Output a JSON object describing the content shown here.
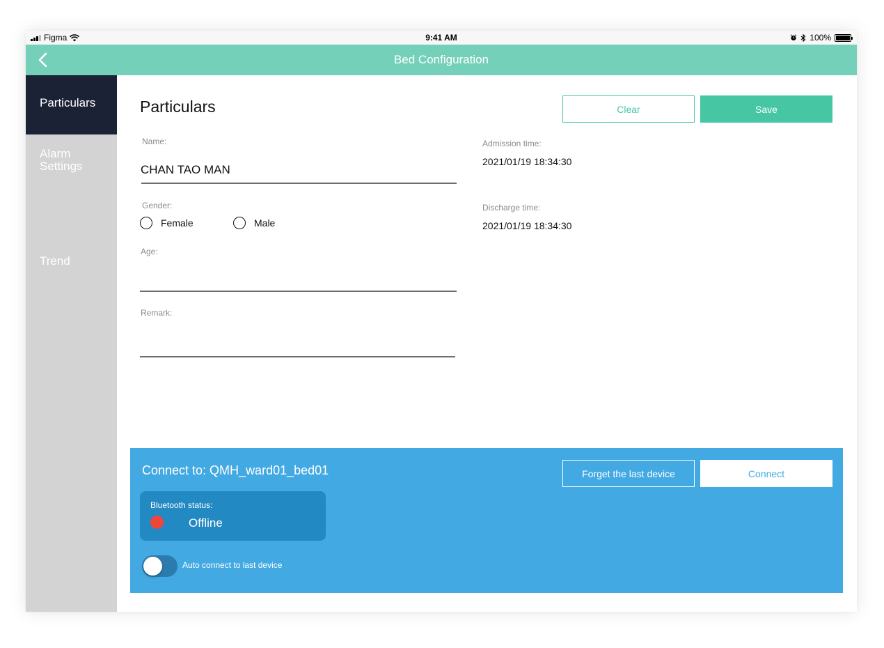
{
  "status_bar": {
    "carrier": "Figma",
    "time": "9:41 AM",
    "battery": "100%",
    "battery_level": 1.0,
    "icons": [
      "signal-icon",
      "wifi-icon",
      "alarm-icon",
      "bluetooth-icon",
      "battery-icon"
    ]
  },
  "nav": {
    "title": "Bed Configuration",
    "back_icon": "chevron-left-icon"
  },
  "sidebar": {
    "items": [
      {
        "label": "Particulars",
        "active": true
      },
      {
        "label": "Alarm Settings",
        "active": false
      },
      {
        "label": "Trend",
        "active": false
      }
    ]
  },
  "main": {
    "title": "Particulars",
    "clear_label": "Clear",
    "save_label": "Save",
    "name_label": "Name:",
    "name_value": "CHAN TAO MAN",
    "gender_label": "Gender:",
    "gender_options": [
      "Female",
      "Male"
    ],
    "age_label": "Age:",
    "age_value": "",
    "remark_label": "Remark:",
    "remark_value": "",
    "admission_label": "Admission time:",
    "admission_value": "2021/01/19 18:34:30",
    "discharge_label": "Discharge time:",
    "discharge_value": "2021/01/19 18:34:30"
  },
  "connect": {
    "title": "Connect to: QMH_ward01_bed01",
    "forget_label": "Forget the last device",
    "connect_label": "Connect",
    "bt_status_label": "Bluetooth status:",
    "bt_status_value": "Offline",
    "auto_connect_label": "Auto connect to last device",
    "auto_connect_on": false
  },
  "colors": {
    "accent": "#74d0b9",
    "primary_button": "#47c6a4",
    "panel_blue": "#42a9e3",
    "sidebar_active": "#1c2236",
    "offline_dot": "#f0463a"
  }
}
